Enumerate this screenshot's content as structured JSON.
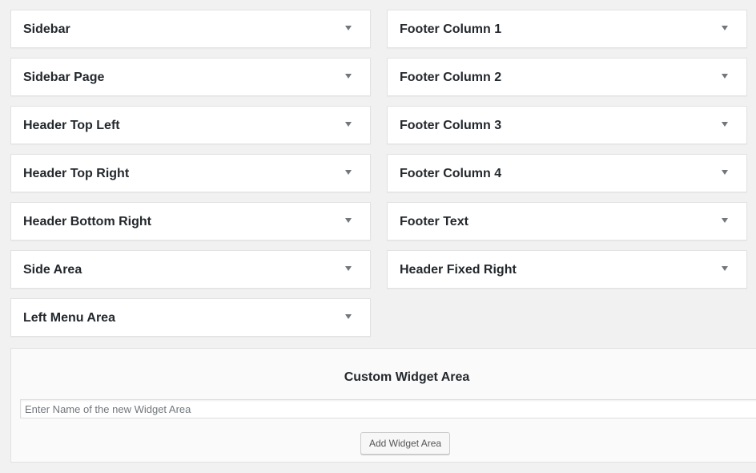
{
  "left_widgets": [
    {
      "title": "Sidebar"
    },
    {
      "title": "Sidebar Page"
    },
    {
      "title": "Header Top Left"
    },
    {
      "title": "Header Top Right"
    },
    {
      "title": "Header Bottom Right"
    },
    {
      "title": "Side Area"
    },
    {
      "title": "Left Menu Area"
    }
  ],
  "right_widgets": [
    {
      "title": "Footer Column 1"
    },
    {
      "title": "Footer Column 2"
    },
    {
      "title": "Footer Column 3"
    },
    {
      "title": "Footer Column 4"
    },
    {
      "title": "Footer Text"
    },
    {
      "title": "Header Fixed Right"
    }
  ],
  "custom_area": {
    "heading": "Custom Widget Area",
    "input_value": "",
    "input_placeholder": "Enter Name of the new Widget Area",
    "button_label": "Add Widget Area"
  },
  "icons": {
    "toggle": "arrow-down-icon"
  }
}
